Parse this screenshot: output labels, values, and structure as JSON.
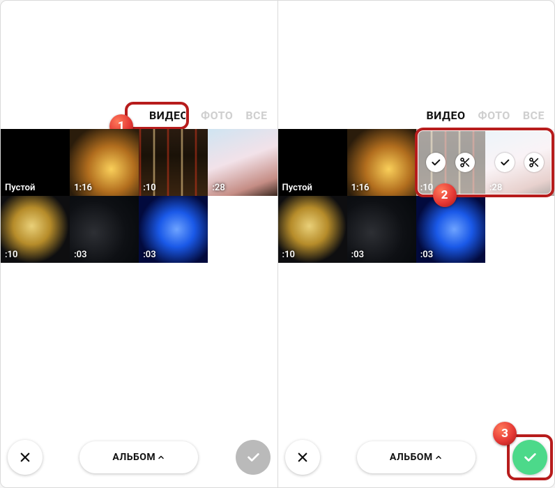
{
  "tabs": {
    "video": "ВИДЕО",
    "photo": "ФОТО",
    "all": "ВСЕ",
    "active": "video"
  },
  "album_label": "АЛЬБОМ",
  "callouts": {
    "1": "1",
    "2": "2",
    "3": "3"
  },
  "left": {
    "tiles": [
      {
        "label": "Пустой",
        "thumb": "empty",
        "selected": false
      },
      {
        "label": "1:16",
        "thumb": "city",
        "selected": false
      },
      {
        "label": ":10",
        "thumb": "traffic",
        "selected": false
      },
      {
        "label": ":28",
        "thumb": "blossom",
        "selected": false
      },
      {
        "label": ":10",
        "thumb": "tree",
        "selected": false
      },
      {
        "label": ":03",
        "thumb": "dark",
        "selected": false
      },
      {
        "label": ":03",
        "thumb": "blue",
        "selected": false
      }
    ]
  },
  "right": {
    "tiles": [
      {
        "label": "Пустой",
        "thumb": "empty",
        "selected": false
      },
      {
        "label": "1:16",
        "thumb": "city",
        "selected": false
      },
      {
        "label": ":10",
        "thumb": "traffic",
        "selected": true
      },
      {
        "label": ":28",
        "thumb": "blossom",
        "selected": true
      },
      {
        "label": ":10",
        "thumb": "tree",
        "selected": false
      },
      {
        "label": ":03",
        "thumb": "dark",
        "selected": false
      },
      {
        "label": ":03",
        "thumb": "blue",
        "selected": false
      }
    ]
  }
}
